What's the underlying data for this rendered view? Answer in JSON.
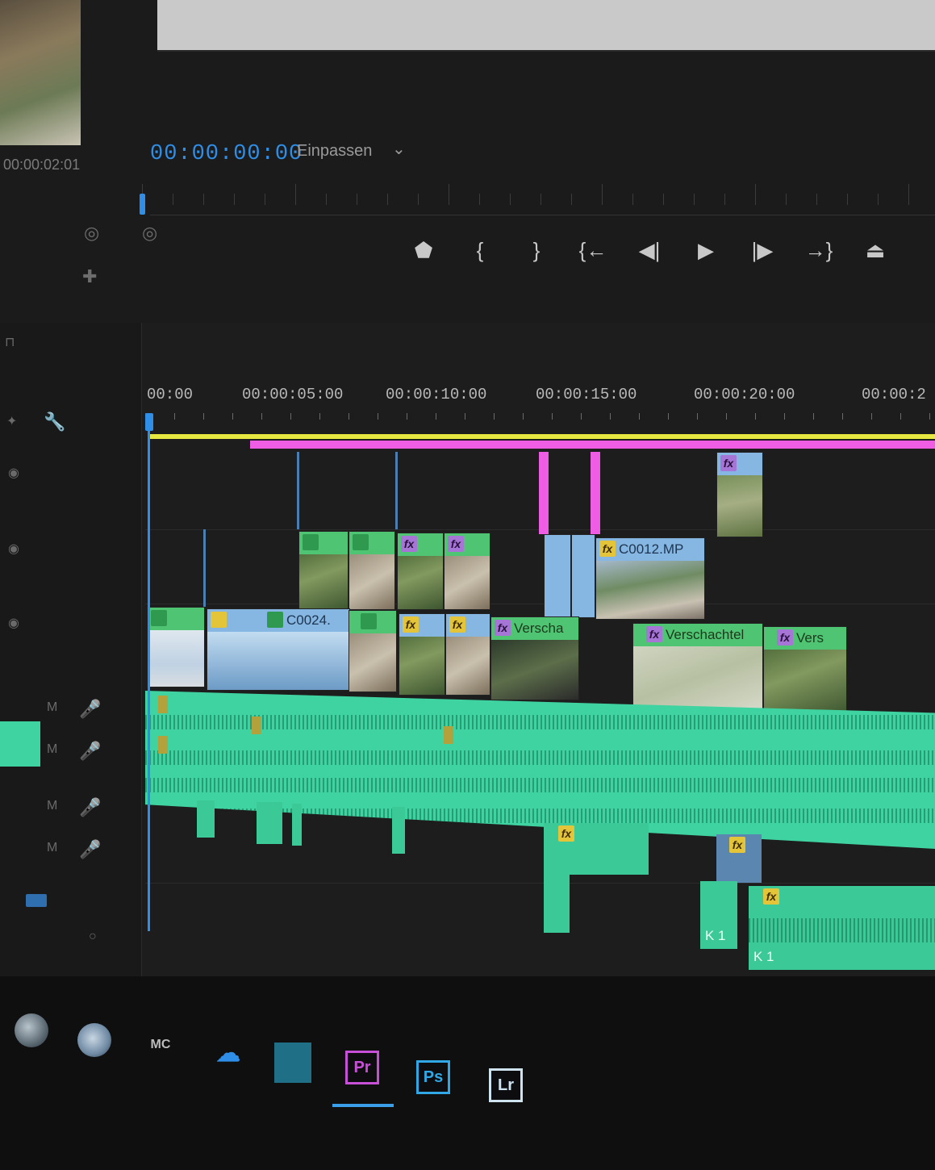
{
  "source_monitor": {
    "timecode": "00:00:02:01"
  },
  "program_monitor": {
    "timecode": "00:00:00:00",
    "zoom": "Einpassen",
    "transport": [
      {
        "name": "add-marker",
        "glyph": "⬟"
      },
      {
        "name": "mark-in",
        "glyph": "{"
      },
      {
        "name": "mark-out",
        "glyph": "}"
      },
      {
        "name": "go-to-in",
        "glyph": "{←"
      },
      {
        "name": "step-back",
        "glyph": "◀|"
      },
      {
        "name": "play",
        "glyph": "▶"
      },
      {
        "name": "step-forward",
        "glyph": "|▶"
      },
      {
        "name": "go-to-out",
        "glyph": "→}"
      },
      {
        "name": "lift",
        "glyph": "⏏"
      }
    ]
  },
  "timeline": {
    "ruler": [
      "00:00",
      "00:00:05:00",
      "00:00:10:00",
      "00:00:15:00",
      "00:00:20:00",
      "00:00:2"
    ],
    "clips": {
      "v3_fx": "fx",
      "v2_c0012": "C0012.MP",
      "v1_c0024": "C0024.",
      "v1_nested_a": "Verscha",
      "v1_nested_b": "Verschachtel",
      "v1_nested_c": "Vers",
      "a_k1_a": "K 1",
      "a_k1_b": "K 1"
    },
    "colors": {
      "video_green": "#4fc574",
      "video_blue": "#86b6e2",
      "audio": "#3fd3a1",
      "work_area": "#e7e742",
      "in_out": "#ee5de3",
      "playhead": "#2f8fe8"
    }
  },
  "taskbar": {
    "apps": [
      {
        "name": "firefox",
        "label": ""
      },
      {
        "name": "steam",
        "label": ""
      },
      {
        "name": "music",
        "label": "MC"
      },
      {
        "name": "cloud",
        "label": ""
      },
      {
        "name": "files",
        "label": ""
      },
      {
        "name": "premiere",
        "label": "Pr"
      },
      {
        "name": "photoshop",
        "label": "Ps"
      },
      {
        "name": "lightroom",
        "label": "Lr"
      }
    ]
  }
}
